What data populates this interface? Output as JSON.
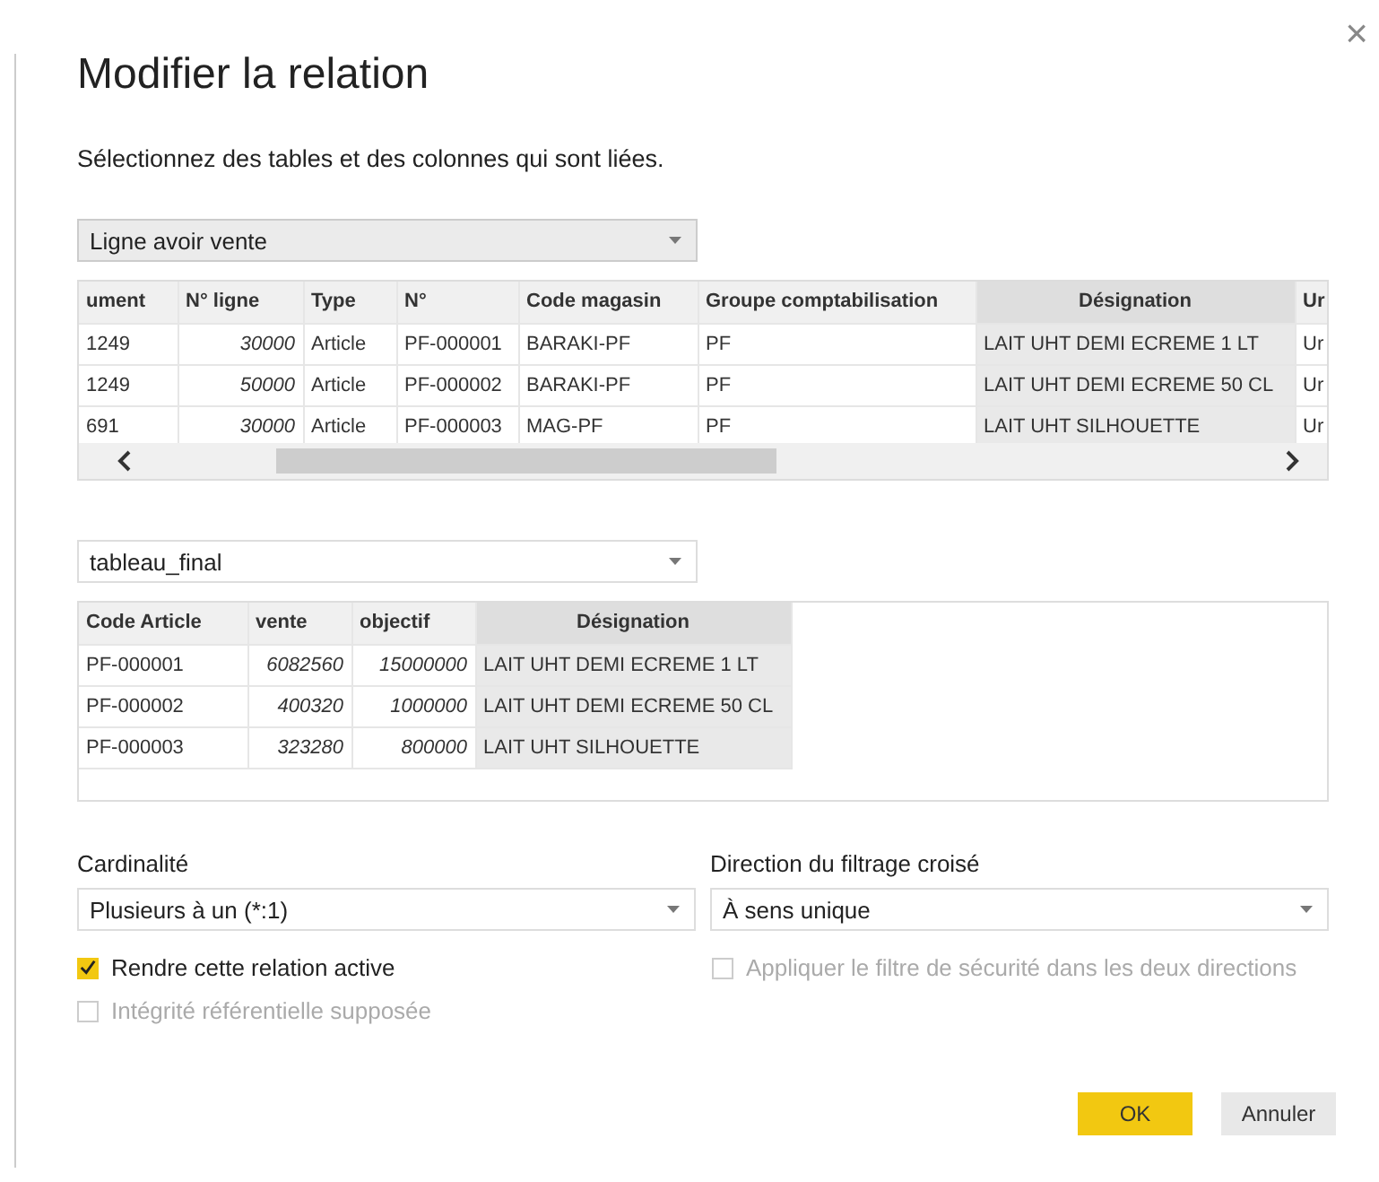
{
  "dialog": {
    "title": "Modifier la relation",
    "subtitle": "Sélectionnez des tables et des colonnes qui sont liées.",
    "close": "×"
  },
  "tables": [
    {
      "dropdown": {
        "value": "Ligne avoir vente",
        "shaded": true
      },
      "columns": [
        {
          "label": "ument",
          "selected": false,
          "kind": "text"
        },
        {
          "label": "N° ligne",
          "selected": false,
          "kind": "number"
        },
        {
          "label": "Type",
          "selected": false,
          "kind": "text"
        },
        {
          "label": "N°",
          "selected": false,
          "kind": "text"
        },
        {
          "label": "Code magasin",
          "selected": false,
          "kind": "text"
        },
        {
          "label": "Groupe comptabilisation",
          "selected": false,
          "kind": "text"
        },
        {
          "label": "Désignation",
          "selected": true,
          "kind": "text"
        },
        {
          "label": "Ur",
          "selected": false,
          "kind": "text"
        }
      ],
      "rows": [
        [
          "1249",
          "30000",
          "Article",
          "PF-000001",
          "BARAKI-PF",
          "PF",
          "LAIT UHT DEMI ECREME 1 LT",
          "Ur"
        ],
        [
          "1249",
          "50000",
          "Article",
          "PF-000002",
          "BARAKI-PF",
          "PF",
          "LAIT UHT DEMI ECREME 50 CL",
          "Ur"
        ],
        [
          "691",
          "30000",
          "Article",
          "PF-000003",
          "MAG-PF",
          "PF",
          "LAIT UHT SILHOUETTE",
          "Ur"
        ]
      ],
      "scrollbar": true
    },
    {
      "dropdown": {
        "value": "tableau_final",
        "shaded": false
      },
      "columns": [
        {
          "label": "Code Article",
          "selected": false,
          "kind": "text"
        },
        {
          "label": "vente",
          "selected": false,
          "kind": "number"
        },
        {
          "label": "objectif",
          "selected": false,
          "kind": "number"
        },
        {
          "label": "Désignation",
          "selected": true,
          "kind": "text"
        }
      ],
      "rows": [
        [
          "PF-000001",
          "6082560",
          "15000000",
          "LAIT UHT DEMI ECREME 1 LT"
        ],
        [
          "PF-000002",
          "400320",
          "1000000",
          "LAIT UHT DEMI ECREME 50 CL"
        ],
        [
          "PF-000003",
          "323280",
          "800000",
          "LAIT UHT SILHOUETTE"
        ]
      ],
      "scrollbar": false
    }
  ],
  "cardinality": {
    "label": "Cardinalité",
    "value": "Plusieurs à un (*:1)"
  },
  "cross_filter": {
    "label": "Direction du filtrage croisé",
    "value": "À sens unique"
  },
  "options": [
    {
      "label": "Rendre cette relation active",
      "checked": true,
      "disabled": false
    },
    {
      "label": "Appliquer le filtre de sécurité dans les deux directions",
      "checked": false,
      "disabled": true
    },
    {
      "label": "Intégrité référentielle supposée",
      "checked": false,
      "disabled": true
    }
  ],
  "buttons": [
    {
      "label": "OK",
      "kind": "primary"
    },
    {
      "label": "Annuler",
      "kind": "secondary"
    }
  ]
}
